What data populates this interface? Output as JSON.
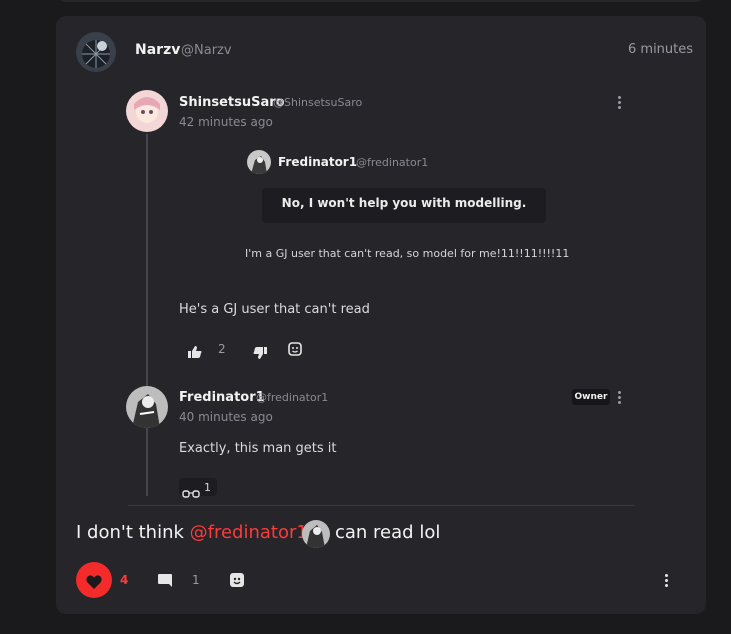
{
  "post": {
    "author": {
      "name": "Narzv",
      "handle": "@Narzv"
    },
    "time": "6 minutes",
    "text_before": "I don't think",
    "mention": "@fredinator1",
    "text_after": "can read lol",
    "like_count": "4",
    "comment_count": "1"
  },
  "comments": [
    {
      "author": {
        "name": "ShinsetsuSaro",
        "handle": "@ShinsetsuSaro"
      },
      "time": "42 minutes ago",
      "embed": {
        "author": {
          "name": "Fredinator1",
          "handle": "@fredinator1"
        },
        "callout": "No, I won't help you with modelling.",
        "body": "I'm a GJ user that can't read, so model for me!11!!11!!!!11"
      },
      "text": "He's a GJ user that can't read",
      "likes": "2"
    },
    {
      "author": {
        "name": "Fredinator1",
        "handle": "@fredinator1"
      },
      "badge": "Owner",
      "time": "40 minutes ago",
      "text": "Exactly, this man gets it",
      "reaction": {
        "emoji": "glasses",
        "count": "1"
      }
    }
  ],
  "colors": {
    "accent_red": "#f42b2b",
    "card_bg": "#25252a",
    "page_bg": "#1a1a1d"
  }
}
